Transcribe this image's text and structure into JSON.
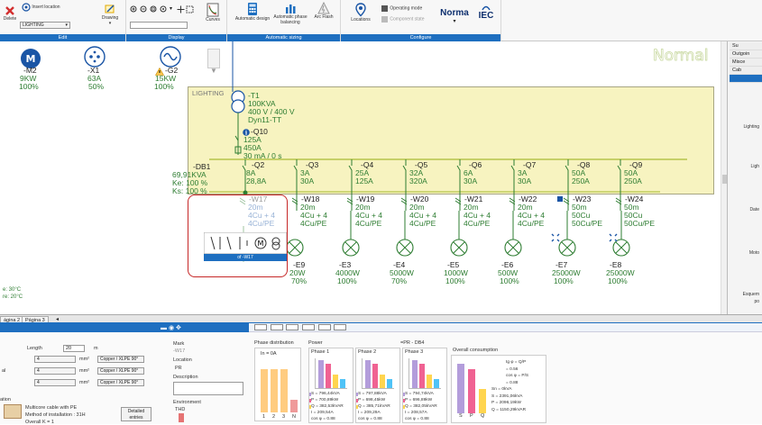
{
  "ribbon": {
    "delete_label": "Delete",
    "insert_location_label": "Insert location",
    "lighting_select": "LIGHTING",
    "drawing_label": "Drawing",
    "curves_label": "Curves",
    "automatic_design_label": "Automatic design",
    "automatic_phase_balancing_label": "Automatic phase balancing",
    "arc_flash_label": "Arc Flash",
    "locations_label": "Locations",
    "operating_mode_label": "Operating mode",
    "component_state_label": "Component state",
    "norma_label": "Norma",
    "iec_label": "IEC",
    "groups": [
      "Edit",
      "Display",
      "Automatic sizing",
      "Configure"
    ]
  },
  "canvas": {
    "mode_watermark": "Normal",
    "top_loads": [
      {
        "id": "-M2",
        "rating": "9KW",
        "pct": "100%"
      },
      {
        "id": "-X1",
        "rating": "63A",
        "pct": "50%"
      },
      {
        "id": "-G2",
        "rating": "15KW",
        "pct": "100%"
      }
    ],
    "board_label": "LIGHTING",
    "transformer": {
      "id": "-T1",
      "power": "100KVA",
      "voltage": "400 V / 400 V",
      "coupling": "Dyn11-TT"
    },
    "main_breaker": {
      "id": "-Q10",
      "rating": "125A",
      "setting": "450A",
      "rcd": "30 mA / 0 s"
    },
    "db": {
      "id": "-DB1",
      "load": "69,91KVA",
      "ke": "Ke: 100 %",
      "ks": "Ks: 100 %"
    },
    "feeder_breakers": [
      {
        "id": "-Q2",
        "a": "8A",
        "b": "28,8A"
      },
      {
        "id": "-Q3",
        "a": "3A",
        "b": "30A"
      },
      {
        "id": "-Q4",
        "a": "25A",
        "b": "125A"
      },
      {
        "id": "-Q5",
        "a": "32A",
        "b": "320A"
      },
      {
        "id": "-Q6",
        "a": "6A",
        "b": "30A"
      },
      {
        "id": "-Q7",
        "a": "3A",
        "b": "30A"
      },
      {
        "id": "-Q8",
        "a": "50A",
        "b": "250A"
      },
      {
        "id": "-Q9",
        "a": "50A",
        "b": "250A"
      }
    ],
    "cables": [
      {
        "id": "-W17",
        "len": "20m",
        "cond": "4Cu + 4",
        "pe": "4Cu/PE"
      },
      {
        "id": "-W18",
        "len": "20m",
        "cond": "4Cu + 4",
        "pe": "4Cu/PE"
      },
      {
        "id": "-W19",
        "len": "20m",
        "cond": "4Cu + 4",
        "pe": "4Cu/PE"
      },
      {
        "id": "-W20",
        "len": "20m",
        "cond": "4Cu + 4",
        "pe": "4Cu/PE"
      },
      {
        "id": "-W21",
        "len": "20m",
        "cond": "4Cu + 4",
        "pe": "4Cu/PE"
      },
      {
        "id": "-W22",
        "len": "20m",
        "cond": "4Cu + 4",
        "pe": "4Cu/PE"
      },
      {
        "id": "-W23",
        "len": "50m",
        "cond": "50Cu",
        "pe": "50Cu/PE"
      },
      {
        "id": "-W24",
        "len": "50m",
        "cond": "50Cu",
        "pe": "50Cu/PE"
      }
    ],
    "lamps": [
      {
        "id": "-E9",
        "power": "20W",
        "pct": "70%"
      },
      {
        "id": "-E3",
        "power": "4000W",
        "pct": "100%"
      },
      {
        "id": "-E4",
        "power": "5000W",
        "pct": "70%"
      },
      {
        "id": "-E5",
        "power": "1000W",
        "pct": "100%"
      },
      {
        "id": "-E6",
        "power": "500W",
        "pct": "100%"
      },
      {
        "id": "-E7",
        "power": "25000W",
        "pct": "100%"
      },
      {
        "id": "-E8",
        "power": "25000W",
        "pct": "100%"
      }
    ],
    "popup_caption": "of -W17",
    "temps": [
      "e: 30°C",
      "re: 20°C"
    ]
  },
  "right_panel": {
    "items": [
      "Su",
      "Outgoin",
      "Misce",
      "Cab",
      ""
    ],
    "labels": [
      "Lighting",
      "Ligh",
      "Date",
      "Moto",
      "Esquem",
      "po"
    ]
  },
  "page_tabs": [
    "ágina 2",
    "Página 3"
  ],
  "bottom": {
    "length_label": "Length",
    "length_value": "20",
    "length_unit": "m",
    "rows": [
      {
        "prefix": "",
        "count": "4",
        "unit": "mm²",
        "material": "Copper / XLPE 90°"
      },
      {
        "prefix": "al",
        "count": "4",
        "unit": "mm²",
        "material": "Copper / XLPE 90°"
      },
      {
        "prefix": "",
        "count": "4",
        "unit": "mm²",
        "material": "Copper / XLPE 90°"
      }
    ],
    "install_heading": "ation",
    "install_lines": [
      "Multicore cable with PE",
      "Method of installation : 31H",
      "Overall K = 1"
    ],
    "detailed_entries_label": "Detailed entries",
    "mark_label": "Mark",
    "mark_value": "-W17",
    "location_label": "Location",
    "location_value": "PR",
    "description_label": "Description",
    "environment_label": "Environment",
    "thd_label": "THD",
    "phase_distribution_label": "Phase distribution",
    "in_label": "In = 0A",
    "pd_axis": [
      "1",
      "2",
      "3",
      "N"
    ],
    "power_label": "Power",
    "pr_db_label": "=PR - DB4",
    "phases": [
      {
        "name": "Phase 1",
        "s": "S = 796,44kVA",
        "p": "P = 700,89kW",
        "q": "Q = 382,53kVAR",
        "i": "I = 209,54A",
        "cos": "cos φ = 0.88"
      },
      {
        "name": "Phase 2",
        "s": "S = 797,88kVA",
        "p": "P = 698,45kW",
        "q": "Q = 385,71kVAR",
        "i": "I = 209,29A",
        "cos": "cos φ = 0.88"
      },
      {
        "name": "Phase 3",
        "s": "S = 794,74kVA",
        "p": "P = 696,89kW",
        "q": "Q = 382,05kVAR",
        "i": "I = 208,57A",
        "cos": "cos φ = 0.88"
      }
    ],
    "overall_label": "Overall consumption",
    "overall_lines": [
      "tg φ = Q/P",
      "= 0.56",
      "cos φ = P/S",
      "= 0.88",
      "Sn = 0kVA",
      "S = 2391,06kVA",
      "P = 2096,19kW",
      "Q = 1150,29kVAR"
    ],
    "overall_axis": [
      "S",
      "P",
      "Q"
    ]
  },
  "colors": {
    "accent": "#1e6fc0",
    "board_fill": "#f7f3c0",
    "schematic_green": "#2e7d32",
    "schematic_blue": "#1a55a5",
    "busbar": "#b5c44a",
    "highlight": "#c62828",
    "bar_s": "#b39ddb",
    "bar_p": "#f06292",
    "bar_q": "#ffd54f",
    "bar_i": "#4fc3f7"
  },
  "icons": [
    "delete-icon",
    "insert-location-icon",
    "drawing-icon",
    "zoom-in-icon",
    "zoom-out-icon",
    "curves-icon",
    "automatic-design-icon",
    "phase-balancing-icon",
    "arc-flash-icon",
    "locations-icon",
    "operating-mode-icon",
    "component-state-icon",
    "motor-icon",
    "socket-icon",
    "generator-icon",
    "transformer-icon",
    "breaker-icon",
    "lamp-icon",
    "info-icon",
    "warning-icon"
  ]
}
